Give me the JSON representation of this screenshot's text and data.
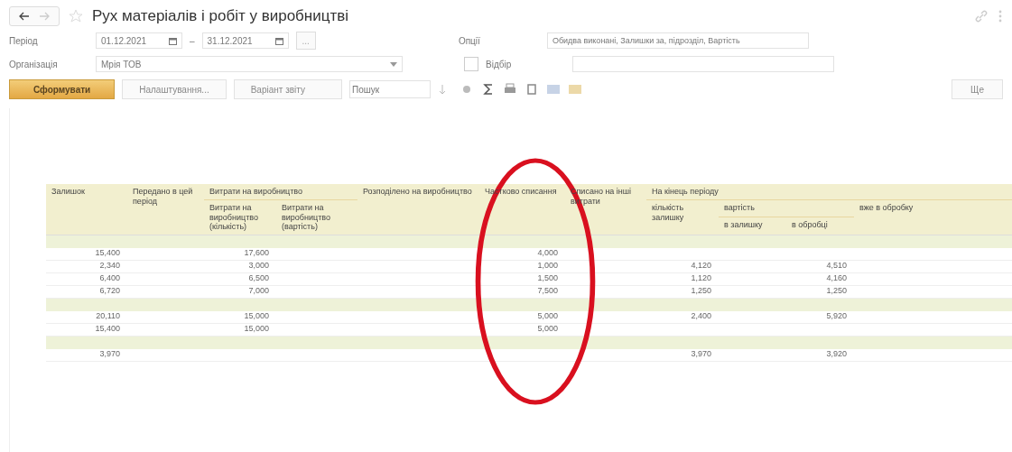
{
  "window": {
    "title": "Рух матеріалів і робіт у виробництві"
  },
  "filters": {
    "period_label": "Період",
    "date_from": "01.12.2021",
    "date_to": "31.12.2021",
    "dash": "–",
    "period_button": "...",
    "options_label": "Опції",
    "options_value": "Обидва виконані, Залишки за, підрозділ, Вартість",
    "org_label": "Організація",
    "org_value": "Мрія ТОВ",
    "selection_label": "Відбір",
    "selection_enabled": false
  },
  "toolbar": {
    "generate": "Сформувати",
    "settings": "Налаштування...",
    "variant": "Варіант звіту",
    "search_placeholder": "Пошук",
    "more": "Ще"
  },
  "table": {
    "columns": [
      {
        "label": "Залишок"
      },
      {
        "label": "Передано в цей період"
      },
      {
        "label": "Витрати на виробництво",
        "children": [
          {
            "label": "Витрати на виробництво (кількість)"
          },
          {
            "label": "Витрати на виробництво (вартість)"
          }
        ]
      },
      {
        "label": "Розподілено на виробництво"
      },
      {
        "label": "Частково списання"
      },
      {
        "label": "Списано на інші витрати"
      },
      {
        "label": "На кінець періоду",
        "children": [
          {
            "label": "кількість залишку"
          },
          {
            "label": "вартість",
            "children": [
              {
                "label": "в залишку"
              },
              {
                "label": "в обробці"
              }
            ]
          },
          {
            "label": "вже в обробку"
          }
        ]
      }
    ],
    "rows": [
      {
        "kind": "group"
      },
      {
        "kind": "data",
        "cells": [
          "15,400",
          null,
          "17,600",
          null,
          null,
          "4,000",
          null,
          null,
          null,
          null,
          null
        ]
      },
      {
        "kind": "data",
        "cells": [
          "2,340",
          null,
          "3,000",
          null,
          null,
          "1,000",
          null,
          "4,120",
          null,
          "4,510",
          null
        ]
      },
      {
        "kind": "data",
        "cells": [
          "6,400",
          null,
          "6,500",
          null,
          null,
          "1,500",
          null,
          "1,120",
          null,
          "4,160",
          null
        ]
      },
      {
        "kind": "data",
        "cells": [
          "6,720",
          null,
          "7,000",
          null,
          null,
          "7,500",
          null,
          "1,250",
          null,
          "1,250",
          null
        ]
      },
      {
        "kind": "group"
      },
      {
        "kind": "data",
        "cells": [
          "20,110",
          null,
          "15,000",
          null,
          null,
          "5,000",
          null,
          "2,400",
          null,
          "5,920",
          null
        ]
      },
      {
        "kind": "data",
        "cells": [
          "15,400",
          null,
          "15,000",
          null,
          null,
          "5,000",
          null,
          null,
          null,
          null,
          null
        ]
      },
      {
        "kind": "group"
      },
      {
        "kind": "data",
        "cells": [
          "3,970",
          null,
          null,
          null,
          null,
          null,
          null,
          "3,970",
          null,
          "3,920",
          null
        ]
      }
    ]
  }
}
